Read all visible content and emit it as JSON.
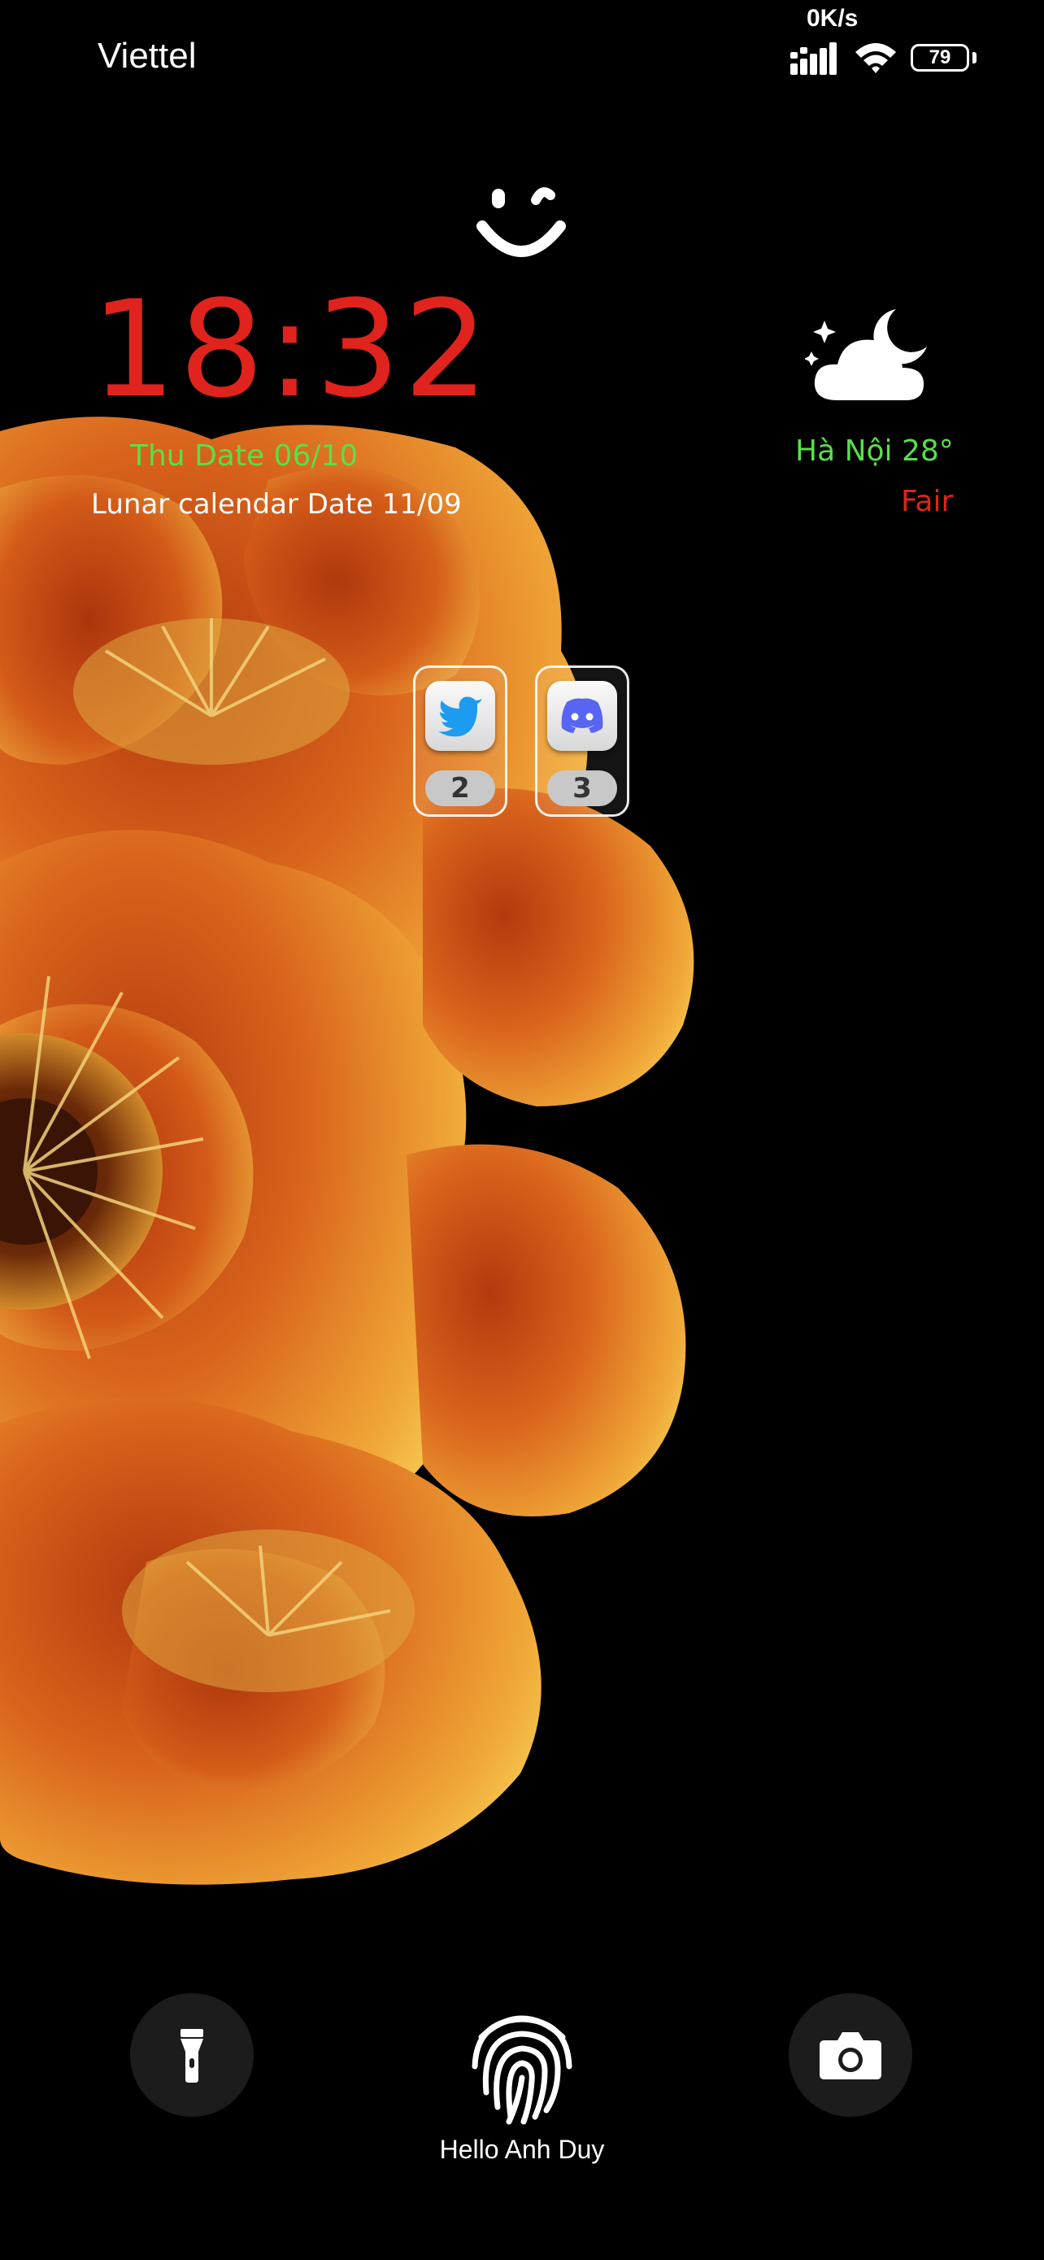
{
  "status_bar": {
    "carrier": "Viettel",
    "net_speed": "0K/s",
    "battery": "79",
    "signal_icon": "signal-icon",
    "wifi_icon": "wifi-icon"
  },
  "lock_screen": {
    "time": "18:32",
    "date": "Thu Date 06/10",
    "lunar": "Lunar calendar Date 11/09",
    "greeting": "Hello Anh Duy"
  },
  "weather": {
    "city_temp": "Hà Nội 28°",
    "condition": "Fair",
    "icon": "moon-cloud-icon"
  },
  "notifications": [
    {
      "app": "twitter-icon",
      "count": "2"
    },
    {
      "app": "discord-icon",
      "count": "3"
    }
  ],
  "controls": {
    "flashlight_icon": "flashlight-icon",
    "fingerprint_icon": "fingerprint-icon",
    "camera_icon": "camera-icon"
  },
  "colors": {
    "clock": "#e0231c",
    "date": "#57e04a",
    "weather_city": "#57e04a",
    "weather_condition": "#e0231c",
    "background": "#000000"
  }
}
